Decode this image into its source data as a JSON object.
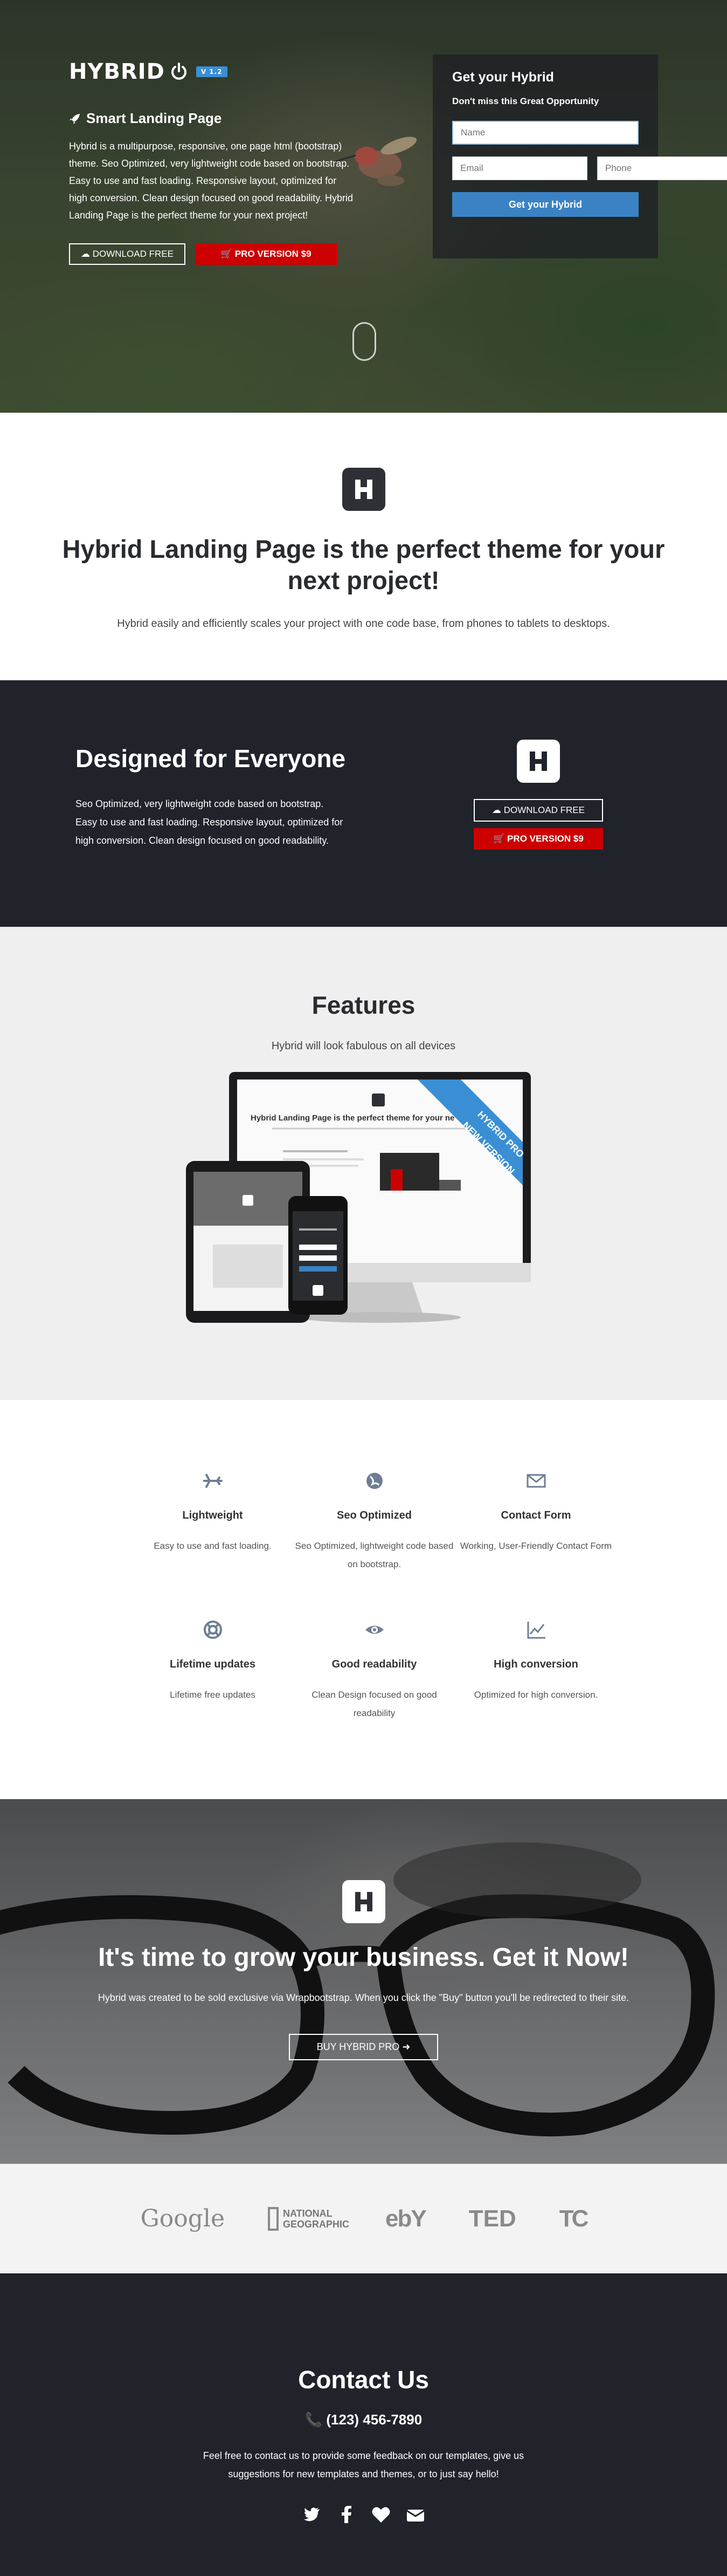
{
  "hero": {
    "brand": "HYBRID",
    "version": "V 1.2",
    "subtitle": "Smart Landing Page",
    "description": "Hybrid is a multipurpose, responsive, one page html (bootstrap) theme. Seo Optimized, very lightweight code based on bootstrap. Easy to use and fast loading. Responsive layout, optimized for high conversion. Clean design focused on good readability. Hybrid Landing Page is the perfect theme for your next project!",
    "download_label": "DOWNLOAD FREE",
    "pro_label": "PRO VERSION $9"
  },
  "form": {
    "title": "Get your Hybrid",
    "subtitle": "Don't miss this Great Opportunity",
    "name_placeholder": "Name",
    "email_placeholder": "Email",
    "phone_placeholder": "Phone",
    "submit_label": "Get your Hybrid"
  },
  "intro": {
    "title": "Hybrid Landing Page is the perfect theme for your next project!",
    "text": "Hybrid easily and efficiently scales your project with one code base, from phones to tablets to desktops."
  },
  "designed": {
    "title": "Designed for Everyone",
    "text": "Seo Optimized, very lightweight code based on bootstrap. Easy to use and fast loading. Responsive layout, optimized for high conversion. Clean design focused on good readability.",
    "download_label": "DOWNLOAD FREE",
    "pro_label": "PRO VERSION $9"
  },
  "features_section": {
    "title": "Features",
    "subtitle": "Hybrid will look fabulous on all devices",
    "ribbon_line1": "HYBRID PRO",
    "ribbon_line2": "NEW VERSION",
    "screen_title": "Hybrid Landing Page is the perfect theme for your ne"
  },
  "features": [
    {
      "icon": "plane-icon",
      "title": "Lightweight",
      "text": "Easy to use and fast loading."
    },
    {
      "icon": "globe-icon",
      "title": "Seo Optimized",
      "text": "Seo Optimized, lightweight code based on bootstrap."
    },
    {
      "icon": "envelope-icon",
      "title": "Contact Form",
      "text": "Working, User-Friendly Contact Form"
    },
    {
      "icon": "lifebuoy-icon",
      "title": "Lifetime updates",
      "text": "Lifetime free updates"
    },
    {
      "icon": "eye-icon",
      "title": "Good readability",
      "text": "Clean Design focused on good readability"
    },
    {
      "icon": "chart-icon",
      "title": "High conversion",
      "text": "Optimized for high conversion."
    }
  ],
  "cta": {
    "title": "It's time to grow your business. Get it Now!",
    "text": "Hybrid was created to be sold exclusive via Wrapbootstrap. When you click the \"Buy\" button you'll be redirected to their site.",
    "button_label": "BUY HYBRID PRO"
  },
  "logos": [
    "Google",
    "NATIONAL GEOGRAPHIC",
    "ebY",
    "TED",
    "TC"
  ],
  "contact": {
    "title": "Contact Us",
    "phone": "(123) 456-7890",
    "text": "Feel free to contact us to provide some feedback on our templates, give us suggestions for new templates and themes, or to just say hello!"
  },
  "colors": {
    "dark": "#20232a",
    "accent_blue": "#3a82c4",
    "accent_red": "#cc0000"
  }
}
